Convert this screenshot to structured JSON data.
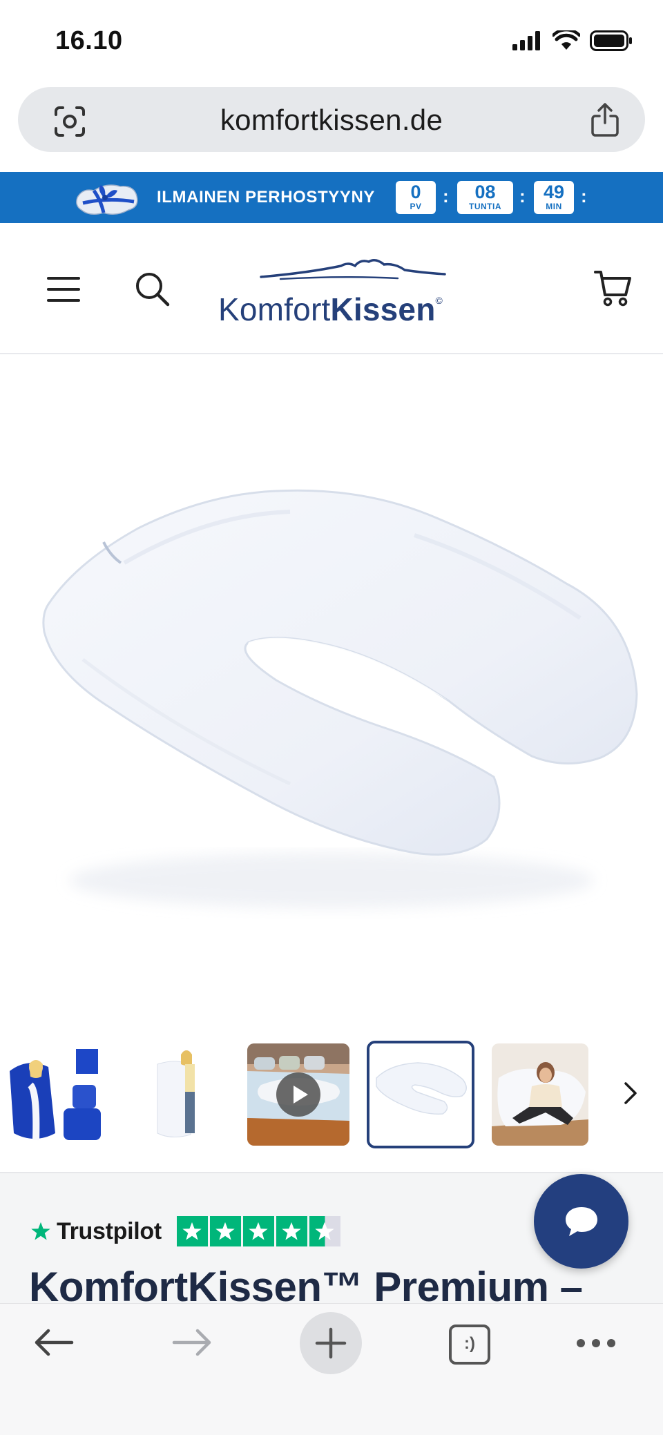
{
  "status_bar": {
    "time": "16.10",
    "icons": [
      "cellular-signal-icon",
      "wifi-icon",
      "battery-icon"
    ]
  },
  "browser": {
    "url": "komfortkissen.de",
    "icons": [
      "visual-lookup-icon",
      "share-icon"
    ]
  },
  "promo_banner": {
    "text": "ILMAINEN PERHOSTYYNY",
    "countdown": [
      {
        "value": "0",
        "unit": "PV"
      },
      {
        "value": "08",
        "unit": "TUNTIA"
      },
      {
        "value": "49",
        "unit": "MIN"
      }
    ],
    "separator": ":",
    "background_color": "#1570c1"
  },
  "header": {
    "logo_light": "Komfort",
    "logo_bold": "Kissen",
    "logo_reg": "©",
    "icons": [
      "menu-icon",
      "search-icon",
      "cart-icon"
    ],
    "brand_color": "#25407a"
  },
  "product": {
    "main_image": "u-shaped-pregnancy-pillow",
    "thumbnails": [
      {
        "name": "blue-pillow-with-woman-and-bag"
      },
      {
        "name": "woman-holding-white-pillow"
      },
      {
        "name": "pillow-on-bed-video",
        "is_video": true
      },
      {
        "name": "u-shaped-pillow",
        "selected": true
      },
      {
        "name": "woman-relaxing-on-pillow"
      }
    ],
    "trustpilot_label": "Trustpilot",
    "rating_stars": 4.5,
    "title": "KomfortKissen™ Premium –"
  },
  "toolbar": {
    "icons": [
      "back-arrow-icon",
      "forward-arrow-icon",
      "new-tab-plus-icon",
      "tabs-icon",
      "more-icon"
    ],
    "tabs_glyph": ":)"
  }
}
